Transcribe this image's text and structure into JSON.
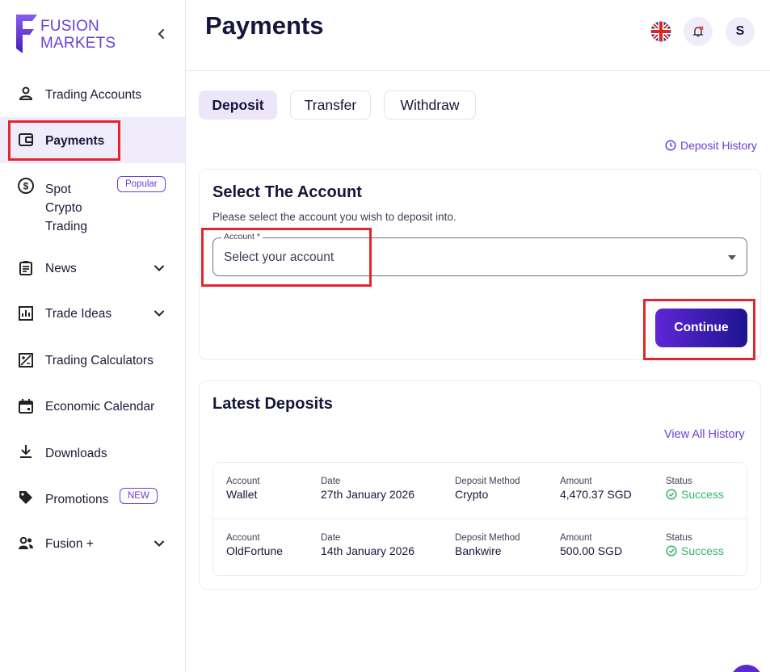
{
  "brand": {
    "line1": "FUSION",
    "line2": "MARKETS"
  },
  "sidebar": {
    "items": [
      {
        "label": "Trading Accounts",
        "icon": "user-icon"
      },
      {
        "label": "Payments",
        "icon": "wallet-icon",
        "active": true
      },
      {
        "label": "Spot\nCrypto\nTrading",
        "icon": "dollar-circle-icon",
        "badge": "Popular"
      },
      {
        "label": "News",
        "icon": "clipboard-icon"
      },
      {
        "label": "Trade Ideas",
        "icon": "bar-chart-icon"
      },
      {
        "label": "Trading Calculators",
        "icon": "calculator-icon"
      },
      {
        "label": "Economic Calendar",
        "icon": "calendar-icon"
      },
      {
        "label": "Downloads",
        "icon": "download-icon"
      },
      {
        "label": "Promotions",
        "icon": "tag-icon",
        "badge": "NEW"
      },
      {
        "label": "Fusion +",
        "icon": "people-icon"
      }
    ]
  },
  "header": {
    "title": "Payments",
    "avatar_initial": "S"
  },
  "tabs": [
    {
      "label": "Deposit",
      "active": true
    },
    {
      "label": "Transfer"
    },
    {
      "label": "Withdraw"
    }
  ],
  "deposit_history_link": "Deposit History",
  "select_account": {
    "title": "Select The Account",
    "subtitle": "Please select the account you wish to deposit into.",
    "field_label": "Account *",
    "placeholder": "Select your account",
    "continue_label": "Continue"
  },
  "latest_deposits": {
    "title": "Latest Deposits",
    "view_all": "View All History",
    "headers": {
      "account": "Account",
      "date": "Date",
      "method": "Deposit Method",
      "amount": "Amount",
      "status": "Status"
    },
    "rows": [
      {
        "account": "Wallet",
        "date": "27th January 2026",
        "method": "Crypto",
        "amount": "4,470.37 SGD",
        "status": "Success"
      },
      {
        "account": "OldFortune",
        "date": "14th January 2026",
        "method": "Bankwire",
        "amount": "500.00 SGD",
        "status": "Success"
      }
    ]
  },
  "colors": {
    "accent": "#6b3fd4",
    "active_bg": "#f1ecfb",
    "highlight": "#e3262d",
    "success": "#35b56a"
  }
}
